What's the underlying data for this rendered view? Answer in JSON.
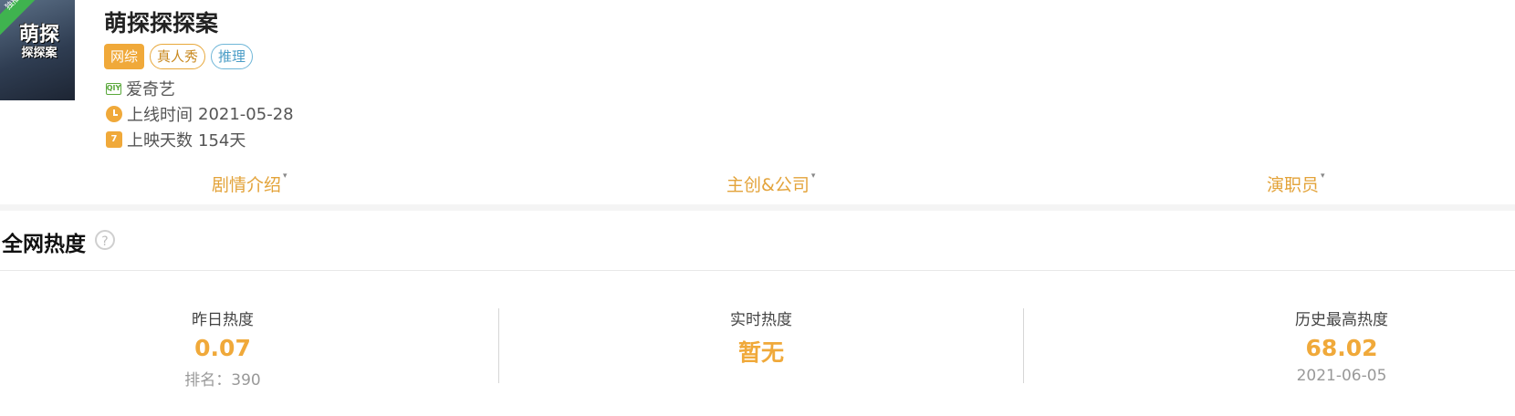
{
  "show": {
    "title": "萌探探探案",
    "poster_badge": "独播",
    "poster_logo": [
      "萌探",
      "探探案"
    ],
    "tags": [
      "网综",
      "真人秀",
      "推理"
    ],
    "platform_icon": "iqiyi-icon",
    "platform_icon_text": "QIY",
    "platform": "爱奇艺",
    "release_label": "上线时间",
    "release_date": "2021-05-28",
    "days_label": "上映天数",
    "days_value": "154天",
    "calendar_icon_text": "7"
  },
  "tabs": [
    "剧情介绍",
    "主创&公司",
    "演职员"
  ],
  "caret": "▾",
  "heat_section": {
    "title": "全网热度",
    "help": "?"
  },
  "stats": [
    {
      "label": "昨日热度",
      "value": "0.07",
      "sub": "排名：390"
    },
    {
      "label": "实时热度",
      "value": "暂无",
      "sub": ""
    },
    {
      "label": "历史最高热度",
      "value": "68.02",
      "sub": "2021-06-05"
    }
  ],
  "colors": {
    "accent": "#f0a93a",
    "tab": "#e3a33a",
    "platform": "#5aa83b",
    "badge": "#3fb34f"
  }
}
